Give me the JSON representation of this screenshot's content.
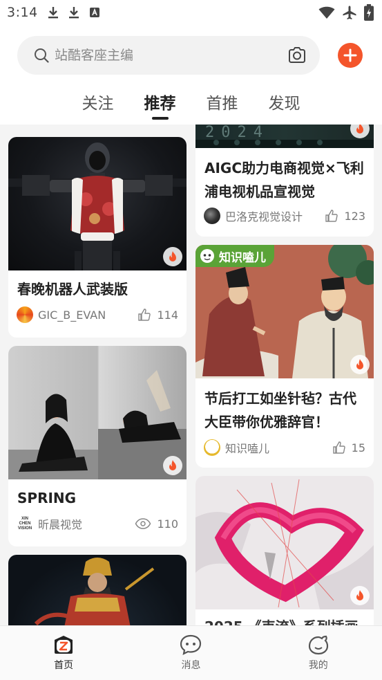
{
  "status_bar": {
    "time": "3:14",
    "icons": [
      "download-icon",
      "download-icon",
      "app-a-icon",
      "wifi-icon",
      "airplane-icon",
      "battery-charging-icon"
    ]
  },
  "search": {
    "placeholder": "站酷客座主编"
  },
  "tabs": [
    {
      "label": "关注",
      "active": false
    },
    {
      "label": "推荐",
      "active": true
    },
    {
      "label": "首推",
      "active": false
    },
    {
      "label": "发现",
      "active": false
    }
  ],
  "feed": {
    "left": [
      {
        "title": "春晚机器人武装版",
        "author": "GIC_B_EVAN",
        "stat_icon": "thumb-up-icon",
        "count": "114",
        "hot": true
      },
      {
        "title": "SPRING",
        "author": "昕晨视觉",
        "author_logo": "XIN CHEN VISION",
        "stat_icon": "eye-icon",
        "count": "110",
        "hot": true
      },
      {
        "title": "",
        "author": "",
        "count": ""
      }
    ],
    "right": [
      {
        "cover_text": "2024",
        "title": "AIGC助力电商视觉×飞利浦电视机品宣视觉(202...",
        "author": "巴洛克视觉设计",
        "stat_icon": "thumb-up-icon",
        "count": "123",
        "hot": true
      },
      {
        "tag": "知识嗑儿",
        "title": "节后打工如坐针毡？古代大臣带你优雅辞官！",
        "author": "知识嗑儿",
        "stat_icon": "thumb-up-icon",
        "count": "15",
        "hot": true
      },
      {
        "title_partial": "2025 《束流》系列插画",
        "hot": true
      }
    ]
  },
  "bottom_nav": [
    {
      "label": "首页",
      "icon": "home-z-icon",
      "active": true
    },
    {
      "label": "消息",
      "icon": "message-icon",
      "active": false
    },
    {
      "label": "我的",
      "icon": "profile-icon",
      "active": false
    }
  ],
  "colors": {
    "accent": "#f4552b",
    "tag_green": "#5aa337",
    "feed_bg": "#f4f4f4"
  }
}
